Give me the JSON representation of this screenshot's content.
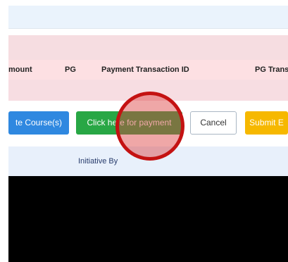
{
  "table": {
    "columns": [
      "mount",
      "PG",
      "Payment Transaction ID",
      "PG Trans"
    ]
  },
  "actions": {
    "courses_label": "te Course(s)",
    "payment_label": "Click here for payment",
    "cancel_label": "Cancel",
    "submit_label": "Submit E"
  },
  "footer": {
    "initiative_label": "Initiative By"
  },
  "colors": {
    "green_button": "#28a745",
    "blue_button": "#2f88e0",
    "yellow_button": "#f6b800",
    "highlight_ring": "#c41212"
  }
}
